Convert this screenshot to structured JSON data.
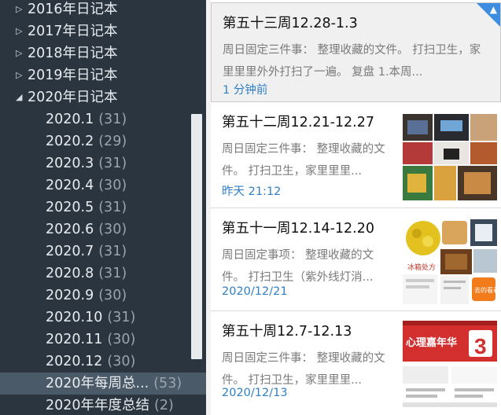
{
  "sidebar": {
    "years": [
      {
        "label": "2016年日记本",
        "arrow": "▷"
      },
      {
        "label": "2017年日记本",
        "arrow": "▷"
      },
      {
        "label": "2018年日记本",
        "arrow": "▷"
      },
      {
        "label": "2019年日记本",
        "arrow": "▷"
      },
      {
        "label": "2020年日记本",
        "arrow": "◢"
      }
    ],
    "months": [
      {
        "label": "2020.1",
        "count": "(31)"
      },
      {
        "label": "2020.2",
        "count": "(29)"
      },
      {
        "label": "2020.3",
        "count": "(31)"
      },
      {
        "label": "2020.4",
        "count": "(30)"
      },
      {
        "label": "2020.5",
        "count": "(31)"
      },
      {
        "label": "2020.6",
        "count": "(30)"
      },
      {
        "label": "2020.7",
        "count": "(31)"
      },
      {
        "label": "2020.8",
        "count": "(31)"
      },
      {
        "label": "2020.9",
        "count": "(30)"
      },
      {
        "label": "2020.10",
        "count": "(31)"
      },
      {
        "label": "2020.11",
        "count": "(30)"
      },
      {
        "label": "2020.12",
        "count": "(30)"
      },
      {
        "label": "2020年每周总...",
        "count": "(53)"
      },
      {
        "label": "2020年年度总结",
        "count": "(2)"
      }
    ],
    "selected_index": 12
  },
  "notes": [
    {
      "title": "第五十三周12.28-1.3",
      "snippet": "周日固定三件事： 整理收藏的文件。 打扫卫生，家里里里外外打扫了一遍。 复盘 1.本周...",
      "time": "1 分钟前",
      "active": true
    },
    {
      "title": "第五十二周12.21-12.27",
      "snippet": "周日固定三件事： 整理收藏的文件。 打扫卫生，家里里里...",
      "time": "昨天 21:12",
      "active": false
    },
    {
      "title": "第五十一周12.14-12.20",
      "snippet": "周日固定事项： 整理收藏的文件。 打扫卫生（紫外线灯消...",
      "time": "2020/12/21",
      "active": false
    },
    {
      "title": "第五十周12.7-12.13",
      "snippet": "周日固定三件事： 整理收藏的文件。 打扫卫生，家里里里...",
      "time": "2020/12/13",
      "active": false
    }
  ],
  "thumb_text": {
    "banner": "心理嘉年华",
    "badge": "3",
    "label": "冰箱处方",
    "subbadge": "去的看看"
  },
  "colors": {
    "sidebar_bg": "#2b3540",
    "selected_bg": "#4b5a68",
    "time_blue": "#2f7fc7",
    "badge_blue": "#3d8ee0"
  }
}
